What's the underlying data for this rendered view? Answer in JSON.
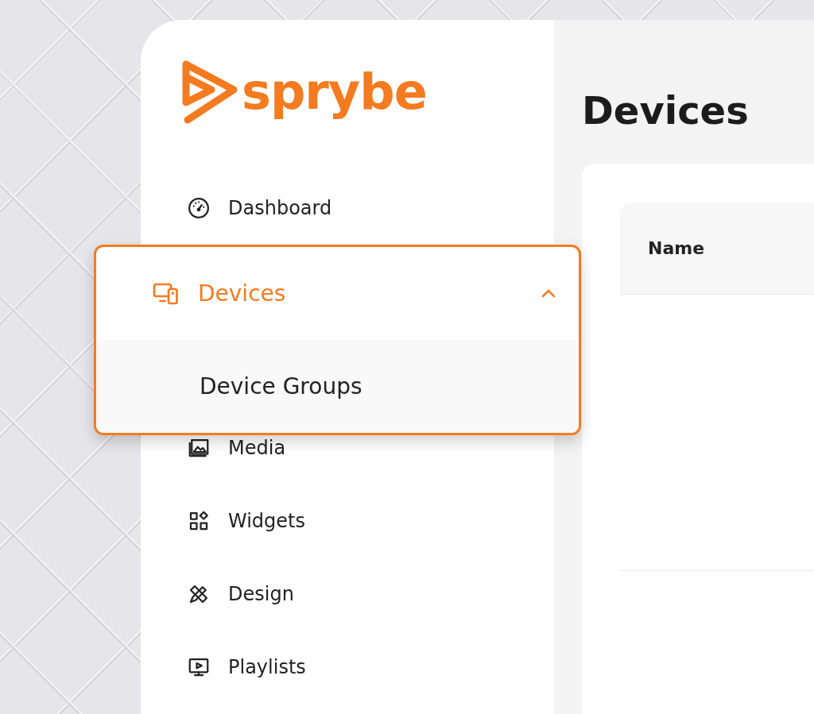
{
  "logo": {
    "text": "sprybe"
  },
  "nav": [
    {
      "kind": "item",
      "label": "Dashboard"
    },
    {
      "kind": "group",
      "label": "Devices",
      "expanded": true,
      "children": [
        {
          "label": "Device Groups"
        }
      ]
    },
    {
      "kind": "item",
      "label": "Media"
    },
    {
      "kind": "item",
      "label": "Widgets"
    },
    {
      "kind": "item",
      "label": "Design"
    },
    {
      "kind": "item",
      "label": "Playlists"
    }
  ],
  "page": {
    "title": "Devices"
  },
  "table": {
    "columns": [
      "Name"
    ]
  }
}
